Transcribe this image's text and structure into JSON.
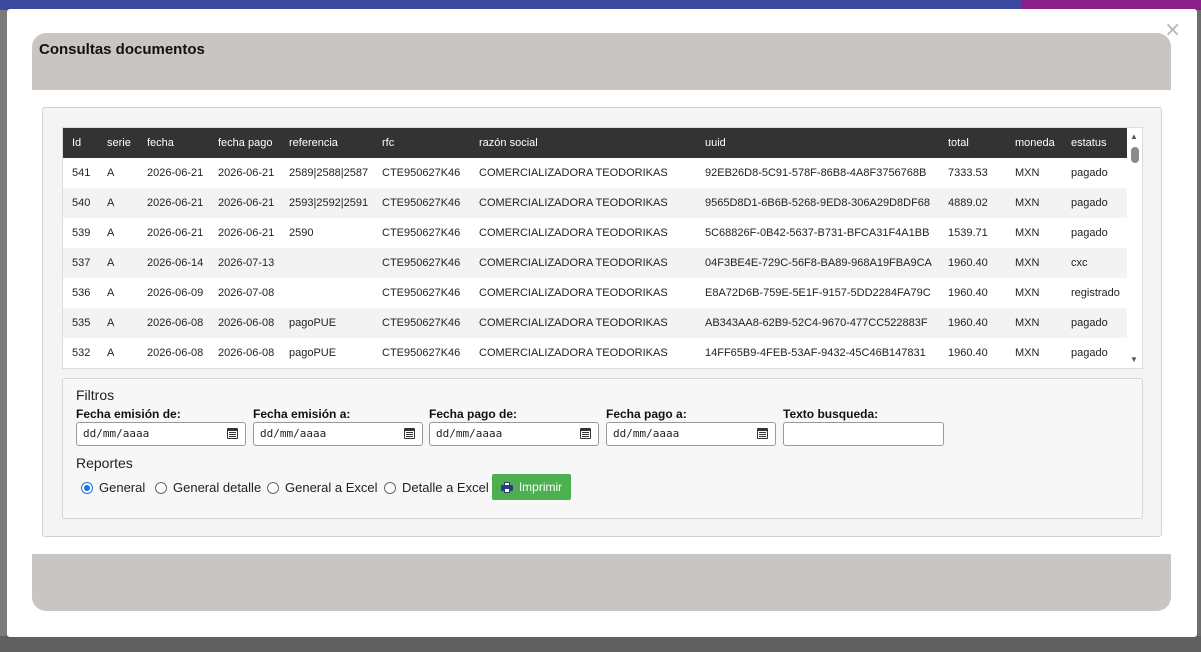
{
  "modal": {
    "title": "Consultas documentos",
    "close": "×"
  },
  "table": {
    "columns": [
      "Id",
      "serie",
      "fecha",
      "fecha pago",
      "referencia",
      "rfc",
      "razón social",
      "uuid",
      "total",
      "moneda",
      "estatus"
    ],
    "rows": [
      [
        "541",
        "A",
        "2026-06-21",
        "2026-06-21",
        "2589|2588|2587",
        "CTE950627K46",
        "COMERCIALIZADORA TEODORIKAS",
        "92EB26D8-5C91-578F-86B8-4A8F3756768B",
        "7333.53",
        "MXN",
        "pagado"
      ],
      [
        "540",
        "A",
        "2026-06-21",
        "2026-06-21",
        "2593|2592|2591",
        "CTE950627K46",
        "COMERCIALIZADORA TEODORIKAS",
        "9565D8D1-6B6B-5268-9ED8-306A29D8DF68",
        "4889.02",
        "MXN",
        "pagado"
      ],
      [
        "539",
        "A",
        "2026-06-21",
        "2026-06-21",
        "2590",
        "CTE950627K46",
        "COMERCIALIZADORA TEODORIKAS",
        "5C68826F-0B42-5637-B731-BFCA31F4A1BB",
        "1539.71",
        "MXN",
        "pagado"
      ],
      [
        "537",
        "A",
        "2026-06-14",
        "2026-07-13",
        "",
        "CTE950627K46",
        "COMERCIALIZADORA TEODORIKAS",
        "04F3BE4E-729C-56F8-BA89-968A19FBA9CA",
        "1960.40",
        "MXN",
        "cxc"
      ],
      [
        "536",
        "A",
        "2026-06-09",
        "2026-07-08",
        "",
        "CTE950627K46",
        "COMERCIALIZADORA TEODORIKAS",
        "E8A72D6B-759E-5E1F-9157-5DD2284FA79C",
        "1960.40",
        "MXN",
        "registrado"
      ],
      [
        "535",
        "A",
        "2026-06-08",
        "2026-06-08",
        "pagoPUE",
        "CTE950627K46",
        "COMERCIALIZADORA TEODORIKAS",
        "AB343AA8-62B9-52C4-9670-477CC522883F",
        "1960.40",
        "MXN",
        "pagado"
      ],
      [
        "532",
        "A",
        "2026-06-08",
        "2026-06-08",
        "pagoPUE",
        "CTE950627K46",
        "COMERCIALIZADORA TEODORIKAS",
        "14FF65B9-4FEB-53AF-9432-45C46B147831",
        "1960.40",
        "MXN",
        "pagado"
      ]
    ]
  },
  "filters": {
    "title": "Filtros",
    "fecha_emision_de": {
      "label": "Fecha emisión de:",
      "placeholder": "dd/mm/aaaa"
    },
    "fecha_emision_a": {
      "label": "Fecha emisión a:",
      "placeholder": "dd/mm/aaaa"
    },
    "fecha_pago_de": {
      "label": "Fecha pago de:",
      "placeholder": "dd/mm/aaaa"
    },
    "fecha_pago_a": {
      "label": "Fecha pago a:",
      "placeholder": "dd/mm/aaaa"
    },
    "texto_busqueda": {
      "label": "Texto busqueda:",
      "value": ""
    }
  },
  "reports": {
    "title": "Reportes",
    "options": [
      {
        "label": "General",
        "checked": true
      },
      {
        "label": "General detalle",
        "checked": false
      },
      {
        "label": "General a Excel",
        "checked": false
      },
      {
        "label": "Detalle a Excel",
        "checked": false
      }
    ],
    "print_label": "Imprimir"
  },
  "colors": {
    "header_bg": "#c9c5c3",
    "table_head": "#333333",
    "print_button": "#4caf50",
    "radio_accent": "#1a73e8"
  }
}
